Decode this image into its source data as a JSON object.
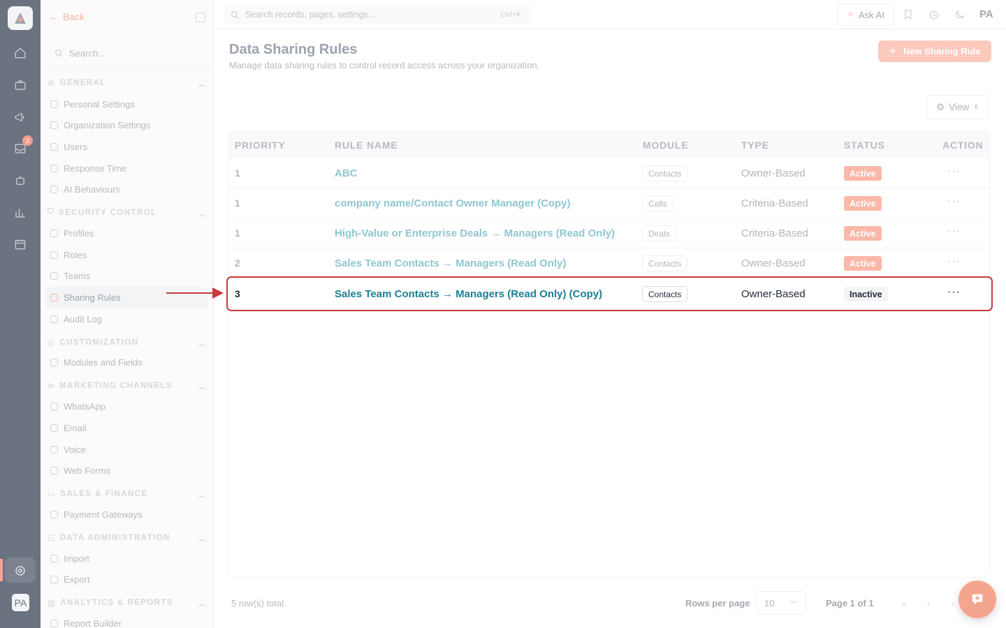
{
  "topbar": {
    "search_placeholder": "Search records, pages, settings...",
    "search_shortcut": "Ctrl+K",
    "ask_ai": "Ask AI",
    "user_initials": "PA"
  },
  "rail": {
    "notification_count": "2",
    "avatar": "PA"
  },
  "sidebar": {
    "back_label": "Back",
    "search_placeholder": "Search...",
    "groups": [
      {
        "label": "GENERAL",
        "items": [
          "Personal Settings",
          "Organization Settings",
          "Users",
          "Response Time",
          "AI Behaviours"
        ]
      },
      {
        "label": "SECURITY CONTROL",
        "items": [
          "Profiles",
          "Roles",
          "Teams",
          "Sharing Rules",
          "Audit Log"
        ]
      },
      {
        "label": "CUSTOMIZATION",
        "items": [
          "Modules and Fields"
        ]
      },
      {
        "label": "MARKETING CHANNELS",
        "items": [
          "WhatsApp",
          "Email",
          "Voice",
          "Web Forms"
        ]
      },
      {
        "label": "SALES & FINANCE",
        "items": [
          "Payment Gateways"
        ]
      },
      {
        "label": "DATA ADMINISTRATION",
        "items": [
          "Import",
          "Export"
        ]
      },
      {
        "label": "ANALYTICS & REPORTS",
        "items": [
          "Report Builder"
        ]
      }
    ],
    "active_item": "Sharing Rules"
  },
  "page": {
    "title": "Data Sharing Rules",
    "subtitle": "Manage data sharing rules to control record access across your organization.",
    "new_button": "New Sharing Rule",
    "view_button": "View"
  },
  "table": {
    "columns": [
      "PRIORITY",
      "RULE NAME",
      "MODULE",
      "TYPE",
      "STATUS",
      "ACTION"
    ],
    "rows": [
      {
        "priority": "1",
        "name": "ABC",
        "module": "Contacts",
        "type": "Owner-Based",
        "status": "Active"
      },
      {
        "priority": "1",
        "name": "company name/Contact Owner Manager (Copy)",
        "module": "Calls",
        "type": "Criteria-Based",
        "status": "Active"
      },
      {
        "priority": "1",
        "name": "High-Value or Enterprise Deals → Managers (Read Only)",
        "module": "Deals",
        "type": "Criteria-Based",
        "status": "Active"
      },
      {
        "priority": "2",
        "name": "Sales Team Contacts → Managers (Read Only)",
        "module": "Contacts",
        "type": "Owner-Based",
        "status": "Active"
      },
      {
        "priority": "3",
        "name": "Sales Team Contacts → Managers (Read Only) (Copy)",
        "module": "Contacts",
        "type": "Owner-Based",
        "status": "Inactive"
      }
    ],
    "action_glyph": "···"
  },
  "footer": {
    "total": "5 row(s) total.",
    "rows_per_page_label": "Rows per page",
    "rows_per_page_value": "10",
    "page_info": "Page 1 of 1"
  },
  "colors": {
    "accent": "#f4a58e",
    "link": "#1d7f94",
    "highlight": "#c8393b"
  }
}
